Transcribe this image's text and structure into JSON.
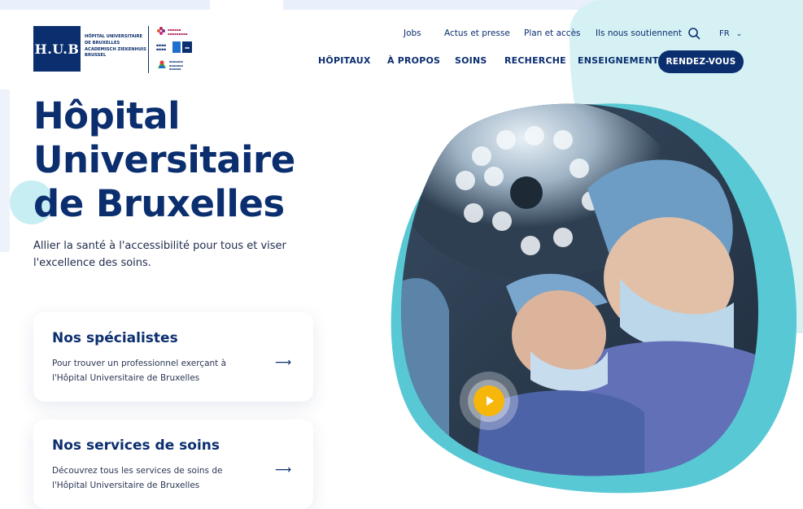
{
  "brand": {
    "logo_text": "H.U.B",
    "logo_lines": [
      "HÔPITAL UNIVERSITAIRE",
      "DE BRUXELLES",
      "ACADEMISCH ZIEKENHUIS",
      "BRUSSEL"
    ],
    "colors": {
      "navy": "#0b2e6f",
      "aqua": "#58c8d4",
      "yellow": "#f6b60a",
      "aqua_light": "#d6f1f4"
    }
  },
  "topnav": {
    "items": [
      "Jobs",
      "Actus et presse",
      "Plan et accès",
      "Ils nous soutiennent"
    ],
    "search_icon": "search-icon",
    "language": "FR"
  },
  "mainnav": {
    "items": [
      "HÔPITAUX",
      "À PROPOS",
      "SOINS",
      "RECHERCHE",
      "ENSEIGNEMENT"
    ],
    "cta": "RENDEZ-VOUS"
  },
  "hero": {
    "title_lines": [
      "Hôpital",
      "Universitaire",
      "de Bruxelles"
    ],
    "subtitle": "Allier la santé à l'accessibilité pour tous et viser l'excellence des soins."
  },
  "cards": [
    {
      "title": "Nos spécialistes",
      "text": "Pour trouver un professionnel exerçant à l'Hôpital Universitaire de Bruxelles",
      "arrow": "⟶"
    },
    {
      "title": "Nos services de soins",
      "text": "Découvrez tous les services de soins de l'Hôpital Universitaire de Bruxelles",
      "arrow": "⟶"
    }
  ],
  "media": {
    "play_icon": "play-icon"
  }
}
